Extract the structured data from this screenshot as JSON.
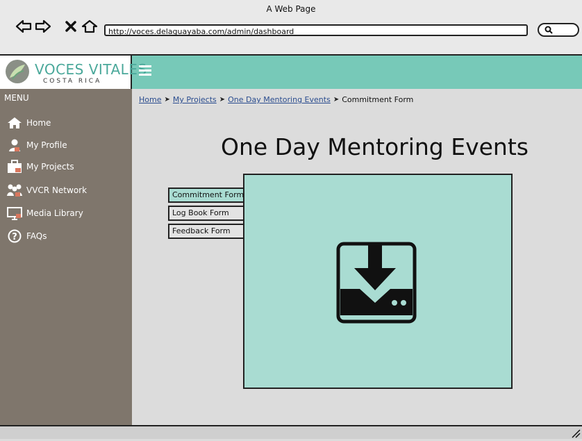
{
  "window": {
    "title": "A Web Page"
  },
  "browser": {
    "url": "http://voces.delaguayaba.com/admin/dashboard",
    "icons": [
      "back-arrow-icon",
      "forward-arrow-icon",
      "close-icon",
      "home-icon",
      "search-icon"
    ]
  },
  "brand": {
    "name": "VOCES VITALES",
    "sub": "COSTA RICA"
  },
  "sidebar": {
    "menu_label": "MENU",
    "items": [
      {
        "label": "Home",
        "icon": "home-icon"
      },
      {
        "label": "My Profile",
        "icon": "user-icon"
      },
      {
        "label": "My Projects",
        "icon": "briefcase-icon"
      },
      {
        "label": "VVCR Network",
        "icon": "network-icon"
      },
      {
        "label": "Media Library",
        "icon": "monitor-icon"
      },
      {
        "label": "FAQs",
        "icon": "question-icon"
      }
    ]
  },
  "breadcrumb": {
    "items": [
      "Home",
      "My Projects",
      "One Day Mentoring Events",
      "Commitment Form"
    ]
  },
  "main": {
    "title": "One Day Mentoring Events",
    "tabs": [
      {
        "label": "Commitment Form",
        "active": true
      },
      {
        "label": "Log Book Form",
        "active": false
      },
      {
        "label": "Feedback Form",
        "active": false
      }
    ],
    "panel_icon": "download-icon"
  },
  "colors": {
    "header": "#77c9b8",
    "sidebar": "#7f766c",
    "panel": "#a9dcd2",
    "link": "#2b4d8f"
  }
}
